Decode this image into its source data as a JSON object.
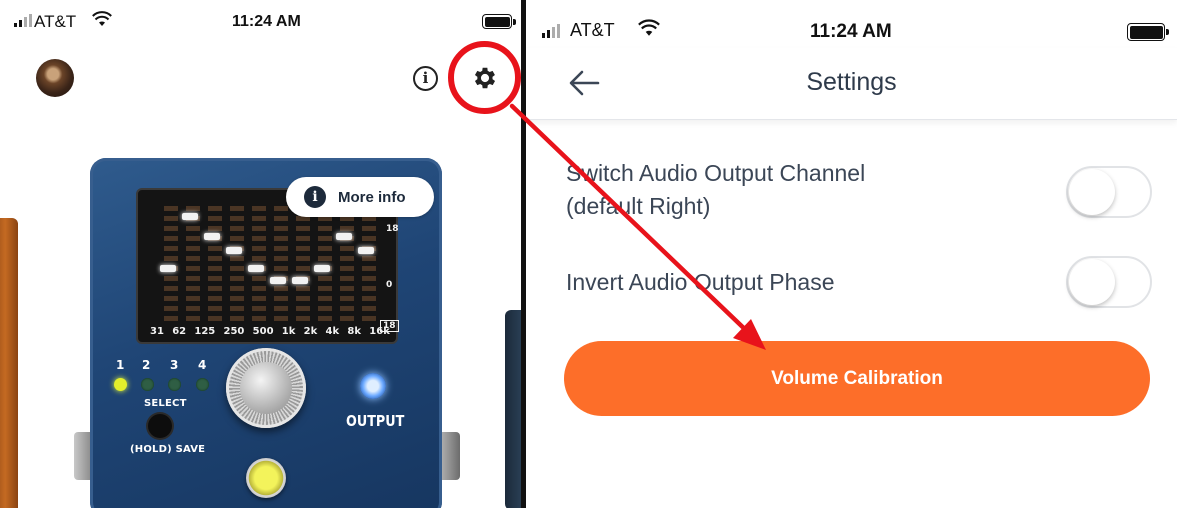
{
  "left_screen": {
    "status_bar": {
      "carrier": "AT&T",
      "time": "11:24 AM"
    },
    "icons": {
      "avatar": "user-avatar",
      "info": "info-icon",
      "settings": "gear-icon"
    },
    "more_info_label": "More info",
    "pedal": {
      "eq_bands": [
        "31",
        "62",
        "125",
        "250",
        "500",
        "1k",
        "2k",
        "4k",
        "8k",
        "16k"
      ],
      "db_top": "18",
      "db_mid": "0",
      "db_bottom": "18",
      "presets": [
        "1",
        "2",
        "3",
        "4"
      ],
      "active_preset": "1",
      "select_label": "SELECT",
      "hold_save_label": "(HOLD) SAVE",
      "output_label": "OUTPUT"
    }
  },
  "right_screen": {
    "status_bar": {
      "carrier": "AT&T",
      "time": "11:24 AM"
    },
    "header": {
      "title": "Settings",
      "back_icon": "back-arrow-icon"
    },
    "settings": [
      {
        "label_line1": "Switch Audio Output Channel",
        "label_line2": "(default Right)",
        "enabled": false
      },
      {
        "label_line1": "Invert Audio Output Phase",
        "enabled": false
      }
    ],
    "primary_button": "Volume Calibration"
  },
  "colors": {
    "accent_orange": "#fd6e29",
    "highlight_red": "#e8131b",
    "pedal_blue": "#1f4575",
    "text_dark": "#2e3a4a"
  }
}
